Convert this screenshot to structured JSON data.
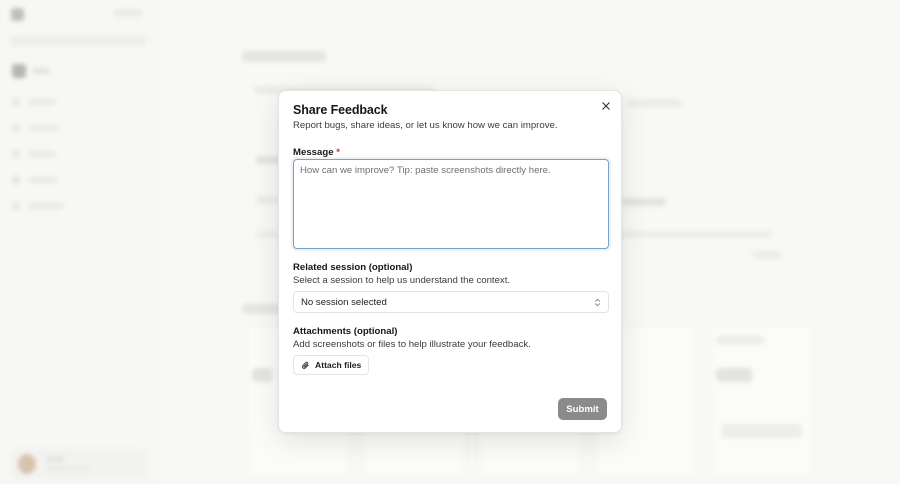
{
  "dialog": {
    "title": "Share Feedback",
    "subtitle": "Report bugs, share ideas, or let us know how we can improve.",
    "close_icon": "close-icon",
    "message": {
      "label": "Message",
      "required_mark": "*",
      "value": "",
      "placeholder": "How can we improve? Tip: paste screenshots directly here."
    },
    "session": {
      "label": "Related session (optional)",
      "hint": "Select a session to help us understand the context.",
      "selected": "No session selected",
      "icon": "chevron-up-down-icon"
    },
    "attachments": {
      "label": "Attachments (optional)",
      "hint": "Add screenshots or files to help illustrate your feedback.",
      "button_label": "Attach files",
      "icon": "paperclip-icon"
    },
    "submit_label": "Submit"
  },
  "colors": {
    "focus_ring": "#7aa3c8",
    "submit_bg": "#8b8b8b",
    "required": "#c23a3a"
  }
}
